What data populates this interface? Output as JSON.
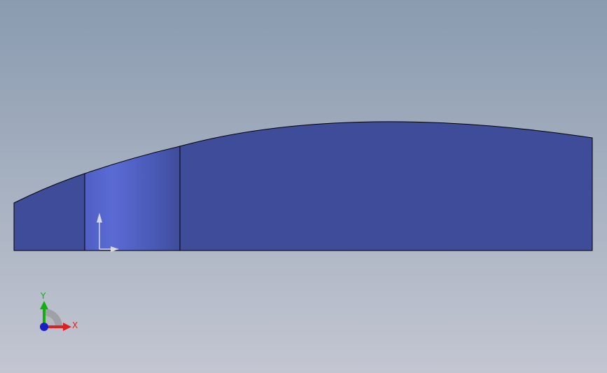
{
  "viewport": {
    "background_top": "#8a9bb0",
    "background_bottom": "#c3c6d1"
  },
  "model": {
    "face_color": "#3f4c9a",
    "highlight_color": "#5a6bd4",
    "edge_color": "#000000"
  },
  "triad": {
    "x_label": "X",
    "y_label": "Y",
    "x_color": "#e02020",
    "y_color": "#10b010",
    "z_color": "#1a20c0"
  },
  "sketch_origin": {
    "color": "#d8d8e0"
  }
}
